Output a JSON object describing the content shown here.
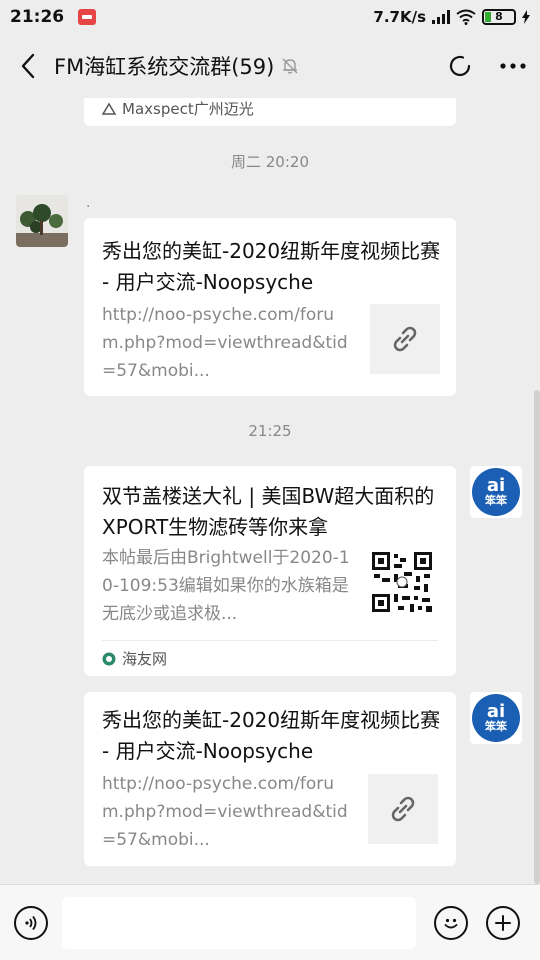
{
  "status_bar": {
    "time": "21:26",
    "net_speed": "7.7K/s",
    "battery": "8"
  },
  "header": {
    "title": "FM海缸系统交流群(59)"
  },
  "messages": {
    "prev_source": "Maxspect广州迈光",
    "time1": "周二 20:20",
    "sender_name": ".",
    "card1": {
      "title": "秀出您的美缸-2020纽斯年度视频比赛 - 用户交流-Noopsyche",
      "desc": "http://noo-psyche.com/forum.php?mod=viewthread&tid=57&mobi..."
    },
    "time2": "21:25",
    "card2": {
      "title": "双节盖楼送大礼 | 美国BW超大面积的XPORT生物滤砖等你来拿",
      "desc": "本帖最后由Brightwell于2020-10-109:53编辑如果你的水族箱是无底沙或追求极...",
      "source": "海友网"
    },
    "card3": {
      "title": "秀出您的美缸-2020纽斯年度视频比赛 - 用户交流-Noopsyche",
      "desc": "http://noo-psyche.com/forum.php?mod=viewthread&tid=57&mobi..."
    },
    "ai_avatar": {
      "big": "ai",
      "small": "笨笨"
    }
  }
}
